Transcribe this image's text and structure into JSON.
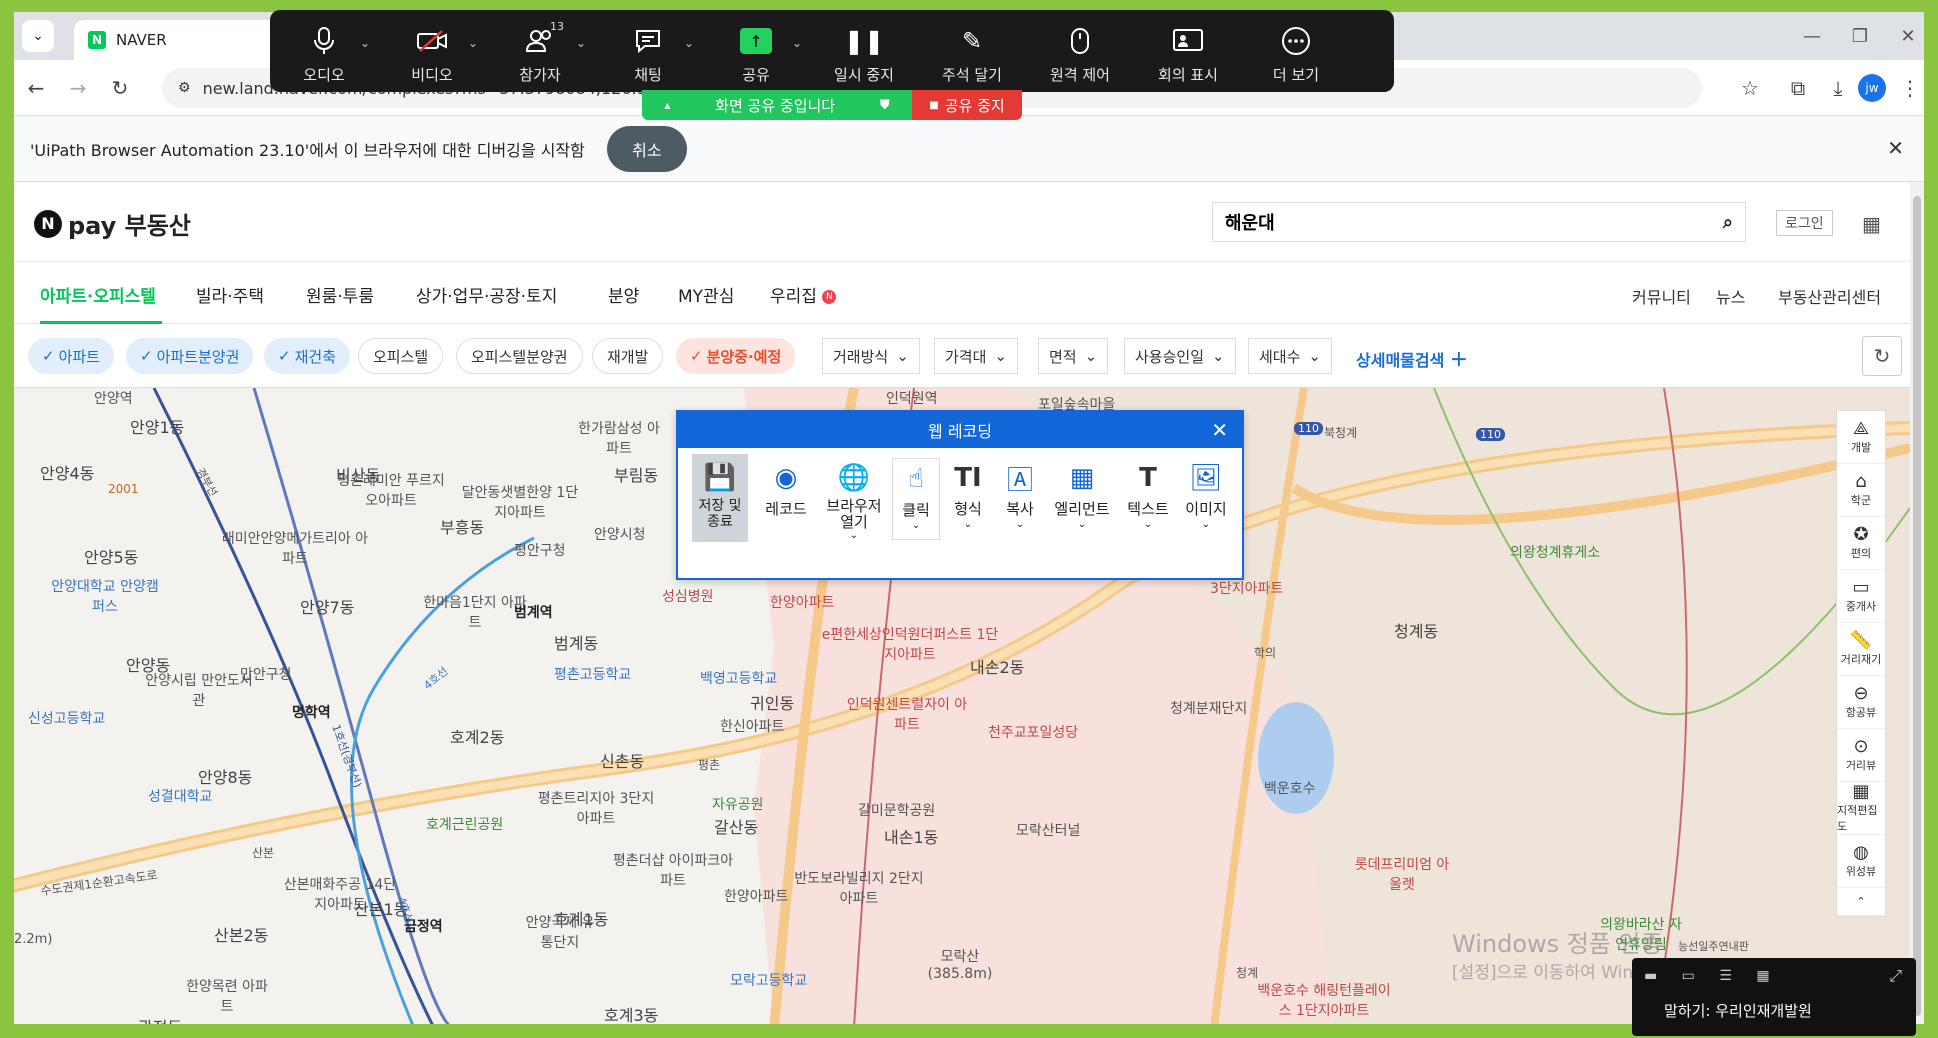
{
  "browser": {
    "tab_title": "NAVER",
    "url": "new.land.naver.com/complexes?ms=37.3798084,126.96",
    "profile_initials": "jw"
  },
  "zoom": {
    "items": [
      {
        "label": "오디오",
        "icon": "microphone-icon"
      },
      {
        "label": "비디오",
        "icon": "video-off-icon"
      },
      {
        "label": "참가자",
        "icon": "participants-icon",
        "count": "13"
      },
      {
        "label": "채팅",
        "icon": "chat-icon"
      },
      {
        "label": "공유",
        "icon": "share-screen-icon"
      },
      {
        "label": "일시 중지",
        "icon": "pause-icon"
      },
      {
        "label": "주석 달기",
        "icon": "annotate-icon"
      },
      {
        "label": "원격 제어",
        "icon": "remote-control-icon"
      },
      {
        "label": "회의 표시",
        "icon": "show-meeting-icon"
      },
      {
        "label": "더 보기",
        "icon": "more-icon"
      }
    ],
    "sharing_label": "화면 공유 중입니다",
    "stop_label": "공유 중지",
    "speaking_label": "말하기: 우리인재개발원"
  },
  "infobar": {
    "message": "'UiPath Browser Automation 23.10'에서 이 브라우저에 대한 디버깅을 시작함",
    "cancel_label": "취소"
  },
  "naver": {
    "logo_text": "pay 부동산",
    "search_value": "해운대",
    "login_label": "로그인",
    "nav": [
      "아파트·오피스텔",
      "빌라·주택",
      "원룸·투룸",
      "상가·업무·공장·토지",
      "분양",
      "MY관심",
      "우리집"
    ],
    "nav_right": [
      "커뮤니티",
      "뉴스",
      "부동산관리센터"
    ],
    "chips": [
      "아파트",
      "아파트분양권",
      "재건축",
      "오피스텔",
      "오피스텔분양권",
      "재개발",
      "분양중·예정"
    ],
    "dropdowns": [
      "거래방식",
      "가격대",
      "면적",
      "사용승인일",
      "세대수"
    ],
    "advanced_search": "상세매물검색"
  },
  "recorder": {
    "title": "웹 레코딩",
    "tools": [
      {
        "label": "저장 및 종료",
        "icon": "save-icon"
      },
      {
        "label": "레코드",
        "icon": "record-icon"
      },
      {
        "label": "브라우저 열기",
        "icon": "browser-open-icon"
      },
      {
        "label": "클릭",
        "icon": "click-icon"
      },
      {
        "label": "형식",
        "icon": "type-icon"
      },
      {
        "label": "복사",
        "icon": "copy-icon"
      },
      {
        "label": "엘리먼트",
        "icon": "element-icon"
      },
      {
        "label": "텍스트",
        "icon": "text-icon"
      },
      {
        "label": "이미지",
        "icon": "image-icon"
      }
    ]
  },
  "maptools": [
    "개발",
    "학군",
    "편의",
    "중개사",
    "거리재기",
    "항공뷰",
    "거리뷰",
    "지적편집도",
    "위성뷰"
  ],
  "map_labels": [
    "안양역",
    "안양1동",
    "안양4동",
    "2001",
    "안양5동",
    "비산동",
    "평촌래미안 푸르지오아파트",
    "달안동샛별한양 1단지아파트",
    "부림동",
    "한가람삼성 아파트",
    "부흥동",
    "안양시청",
    "평안구청",
    "래미안안양메가트리아 아파트",
    "한마음1단지 아파트",
    "범계역",
    "범계동",
    "안양7동",
    "안양대학교 안양캠퍼스",
    "안양동",
    "만안구청",
    "안양시립 만안도서관",
    "명학역",
    "신성고등학교",
    "평촌고등학교",
    "백영고등학교",
    "귀인동",
    "한신아파트",
    "호계2동",
    "신촌동",
    "안양8동",
    "성결대학교",
    "평촌트리지아 3단지아파트",
    "호계근린공원",
    "자유공원",
    "갈산동",
    "산본매화주공 14단지아파트",
    "산본1동",
    "금정역",
    "산본2동",
    "한양목련 아파트",
    "평촌더샵 아이파크아파트",
    "호계1동",
    "안양국제 유통단지",
    "한양아파트",
    "반도보라빌리지 2단지아파트",
    "호계3동",
    "모락고등학교",
    "광정동",
    "내손1동",
    "갈미문학공원",
    "모락산 (385.8m)",
    "모락산터널",
    "천주교포일성당",
    "인덕원센트럴자이 아파트",
    "e편한세상인덕원더퍼스트 1단지아파트",
    "내손2동",
    "청계분재단지",
    "백운호수",
    "롯데프리미엄 아울렛",
    "청계동",
    "의왕청계휴게소",
    "3단지아파트",
    "인덕원역",
    "포일숲속마을",
    "북청계",
    "의왕바라산 자연휴양림",
    "능선일주연내판",
    "백운호수 해링턴플레이스 1단지아파트",
    "수도권제1순환고속도로",
    "4호선",
    "1호선(경부선)",
    "4호선",
    "경부선",
    "성심병원",
    "한양아파트",
    "학의",
    "청계",
    "산본",
    "평촌",
    "110",
    "110",
    "2.2m)"
  ],
  "windows_watermark": {
    "title": "Windows 정품 인증",
    "subtitle": "[설정]으로 이동하여 Windows를 정품 인증합니다."
  }
}
